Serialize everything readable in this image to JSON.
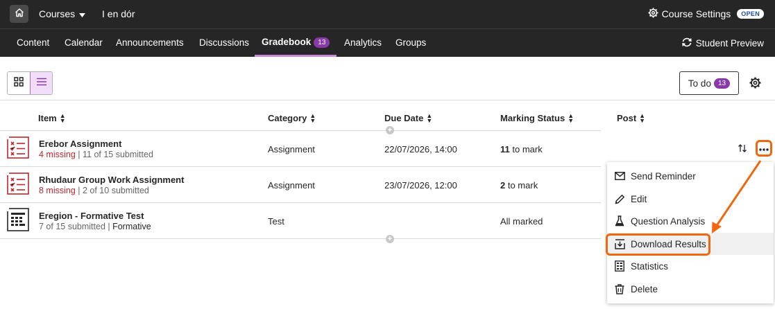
{
  "topbar": {
    "home_icon": "home-icon",
    "courses_label": "Courses",
    "course_name": "I en dór",
    "settings_label": "Course Settings",
    "status_badge": "OPEN"
  },
  "nav": {
    "tabs": [
      {
        "label": "Content"
      },
      {
        "label": "Calendar"
      },
      {
        "label": "Announcements"
      },
      {
        "label": "Discussions"
      },
      {
        "label": "Gradebook",
        "count": "13",
        "active": true
      },
      {
        "label": "Analytics"
      },
      {
        "label": "Groups"
      }
    ],
    "student_preview": "Student Preview"
  },
  "toolbar": {
    "todo_label": "To do",
    "todo_count": "13"
  },
  "table": {
    "headers": [
      "Item",
      "Category",
      "Due Date",
      "Marking Status",
      "Post"
    ],
    "rows": [
      {
        "icon": "assignment-icon",
        "title": "Erebor Assignment",
        "missing": "4 missing",
        "submitted": " | 11 of 15 submitted",
        "category": "Assignment",
        "due": "22/07/2026, 14:00",
        "mark_count": "11",
        "mark_text": " to mark"
      },
      {
        "icon": "assignment-icon",
        "title": "Rhudaur Group Work Assignment",
        "missing": "8 missing",
        "submitted": " | 2 of 10 submitted",
        "category": "Assignment",
        "due": "23/07/2026, 12:00",
        "mark_count": "2",
        "mark_text": " to mark"
      },
      {
        "icon": "test-icon",
        "title": "Eregion - Formative Test",
        "submitted": "7 of 15 submitted | ",
        "formative": "Formative",
        "category": "Test",
        "due": "",
        "marking_status": "All marked"
      }
    ]
  },
  "menu": {
    "items": [
      {
        "label": "Send Reminder",
        "icon": "envelope-icon"
      },
      {
        "label": "Edit",
        "icon": "pencil-icon"
      },
      {
        "label": "Question Analysis",
        "icon": "flask-icon"
      },
      {
        "label": "Download Results",
        "icon": "download-icon",
        "highlighted": true
      },
      {
        "label": "Statistics",
        "icon": "statistics-icon"
      },
      {
        "label": "Delete",
        "icon": "trash-icon"
      }
    ]
  },
  "colors": {
    "header_bg": "#262626",
    "accent_purple": "#8a3aa8",
    "missing_red": "#c0262d",
    "annotation_orange": "#f0670f"
  }
}
